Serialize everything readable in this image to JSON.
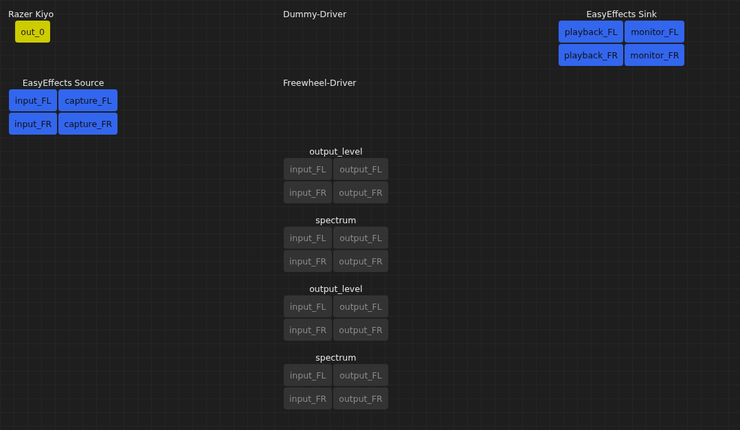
{
  "nodes": [
    {
      "title": "Razer Kiyo",
      "outputs": [
        {
          "label": "out_0",
          "kind": "video"
        }
      ]
    },
    {
      "title": "Dummy-Driver"
    },
    {
      "title": "EasyEffects Sink",
      "inputs": [
        {
          "label": "playback_FL",
          "kind": "audio"
        },
        {
          "label": "playback_FR",
          "kind": "audio"
        }
      ],
      "outputs": [
        {
          "label": "monitor_FL",
          "kind": "audio"
        },
        {
          "label": "monitor_FR",
          "kind": "audio"
        }
      ]
    },
    {
      "title": "EasyEffects Source",
      "inputs": [
        {
          "label": "input_FL",
          "kind": "audio"
        },
        {
          "label": "input_FR",
          "kind": "audio"
        }
      ],
      "outputs": [
        {
          "label": "capture_FL",
          "kind": "audio"
        },
        {
          "label": "capture_FR",
          "kind": "audio"
        }
      ]
    },
    {
      "title": "Freewheel-Driver"
    },
    {
      "title": "output_level",
      "inputs": [
        {
          "label": "input_FL",
          "kind": "inactive"
        },
        {
          "label": "input_FR",
          "kind": "inactive"
        }
      ],
      "outputs": [
        {
          "label": "output_FL",
          "kind": "inactive"
        },
        {
          "label": "output_FR",
          "kind": "inactive"
        }
      ]
    },
    {
      "title": "spectrum",
      "inputs": [
        {
          "label": "input_FL",
          "kind": "inactive"
        },
        {
          "label": "input_FR",
          "kind": "inactive"
        }
      ],
      "outputs": [
        {
          "label": "output_FL",
          "kind": "inactive"
        },
        {
          "label": "output_FR",
          "kind": "inactive"
        }
      ]
    },
    {
      "title": "output_level",
      "inputs": [
        {
          "label": "input_FL",
          "kind": "inactive"
        },
        {
          "label": "input_FR",
          "kind": "inactive"
        }
      ],
      "outputs": [
        {
          "label": "output_FL",
          "kind": "inactive"
        },
        {
          "label": "output_FR",
          "kind": "inactive"
        }
      ]
    },
    {
      "title": "spectrum",
      "inputs": [
        {
          "label": "input_FL",
          "kind": "inactive"
        },
        {
          "label": "input_FR",
          "kind": "inactive"
        }
      ],
      "outputs": [
        {
          "label": "output_FL",
          "kind": "inactive"
        },
        {
          "label": "output_FR",
          "kind": "inactive"
        }
      ]
    }
  ]
}
